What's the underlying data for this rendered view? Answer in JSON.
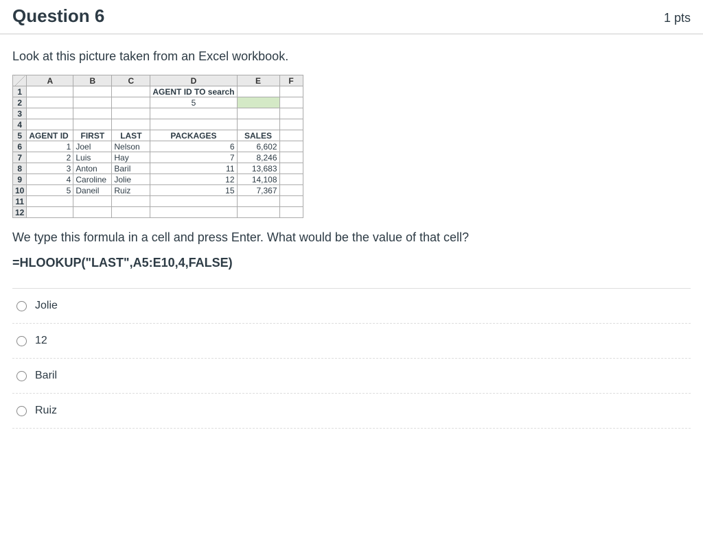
{
  "header": {
    "title": "Question 6",
    "points": "1 pts"
  },
  "stem": {
    "line1": "Look at this picture taken from an Excel workbook.",
    "line2": "We type this formula in a cell and press Enter. What would be the value of that cell?",
    "formula": "=HLOOKUP(\"LAST\",A5:E10,4,FALSE)"
  },
  "excel": {
    "cols": [
      "A",
      "B",
      "C",
      "D",
      "E",
      "F"
    ],
    "d1": "AGENT ID TO search",
    "d2": "5",
    "row5": {
      "a": "AGENT ID",
      "b": "FIRST",
      "c": "LAST",
      "d": "PACKAGES",
      "e": "SALES"
    },
    "data": [
      {
        "id": "1",
        "first": "Joel",
        "last": "Nelson",
        "pkg": "6",
        "sales": "6,602"
      },
      {
        "id": "2",
        "first": "Luis",
        "last": "Hay",
        "pkg": "7",
        "sales": "8,246"
      },
      {
        "id": "3",
        "first": "Anton",
        "last": "Baril",
        "pkg": "11",
        "sales": "13,683"
      },
      {
        "id": "4",
        "first": "Caroline",
        "last": "Jolie",
        "pkg": "12",
        "sales": "14,108"
      },
      {
        "id": "5",
        "first": "Daneil",
        "last": "Ruiz",
        "pkg": "15",
        "sales": "7,367"
      }
    ]
  },
  "answers": [
    "Jolie",
    "12",
    "Baril",
    "Ruiz"
  ]
}
